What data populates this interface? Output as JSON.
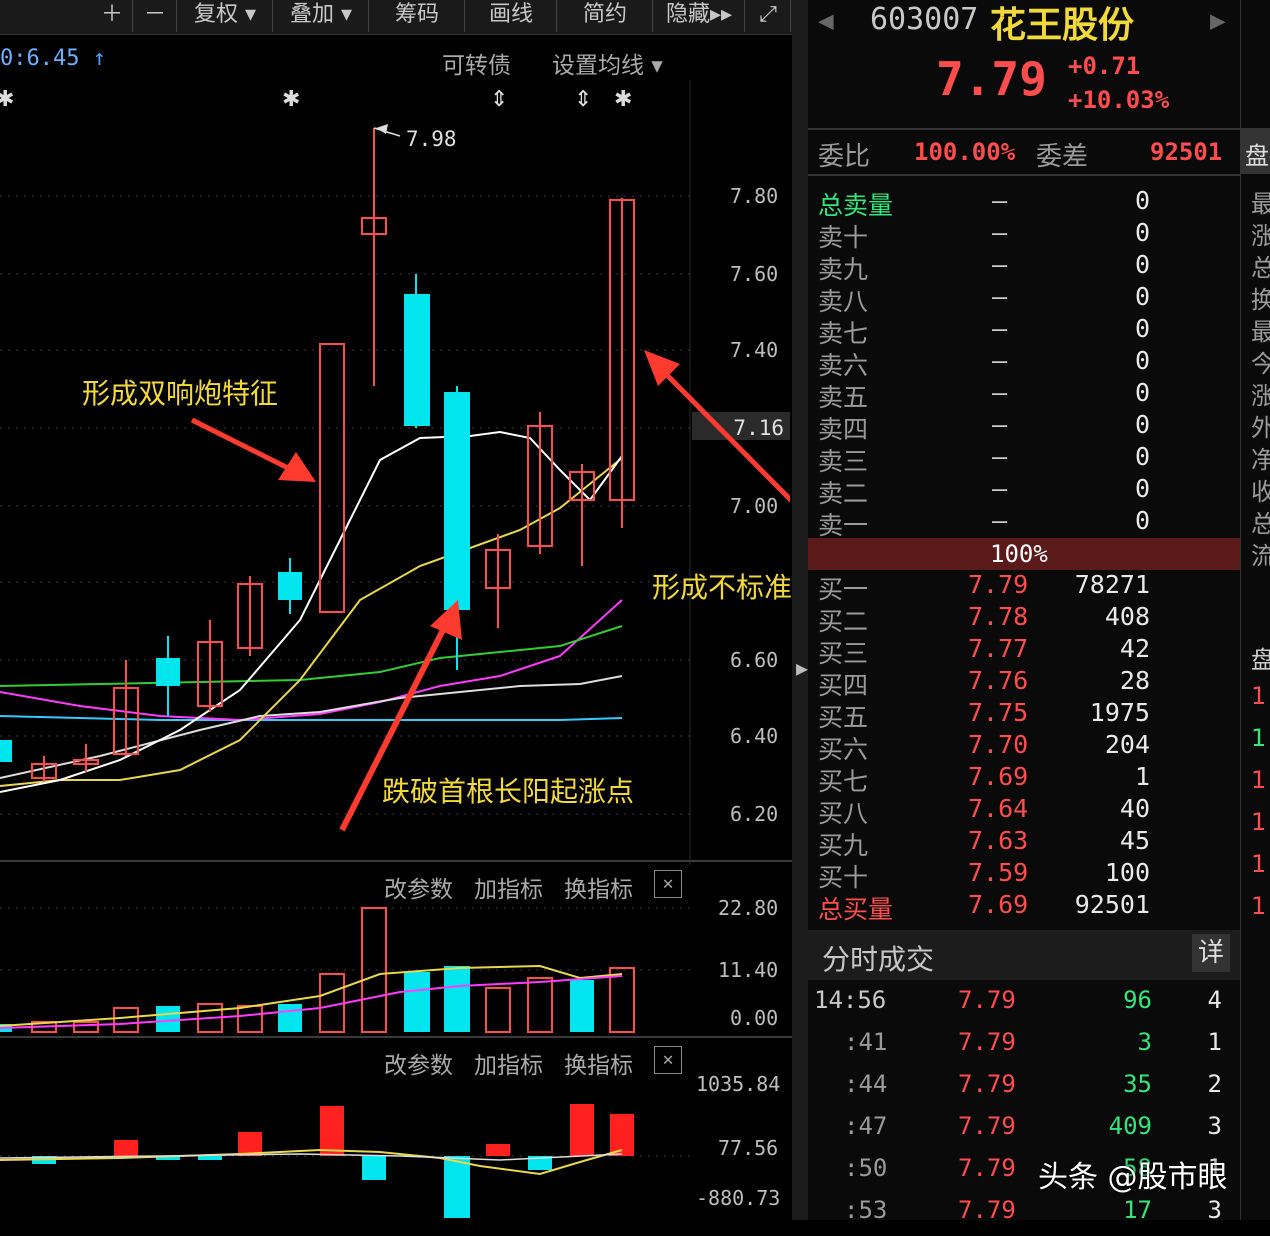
{
  "toolbar": {
    "items": [
      "＋",
      "－",
      "复权 ▾",
      "叠加 ▾",
      "筹码",
      "画线",
      "简约",
      "隐藏▸▸",
      "⤢"
    ]
  },
  "chart_header": {
    "ma_label": "0:6.45",
    "arrow": "↑",
    "convertible": "可转债",
    "set_ma": "设置均线 ▾",
    "high_label": "7.98",
    "current_price_tag": "7.16"
  },
  "price_axis": [
    "7.80",
    "7.60",
    "7.40",
    "7.00",
    "6.60",
    "6.40",
    "6.20"
  ],
  "annotations": {
    "a1": "形成双响炮特征",
    "a2": "跌破首根长阳起涨点",
    "a3": "形成不标准双响炮图形"
  },
  "volume_panel": {
    "buttons": [
      "改参数",
      "加指标",
      "换指标"
    ],
    "close": "✕",
    "axis": [
      "22.80",
      "11.40",
      "0.00"
    ]
  },
  "macd_panel": {
    "buttons": [
      "改参数",
      "加指标",
      "换指标"
    ],
    "close": "✕",
    "axis": [
      "1035.84",
      "77.56",
      "-880.73"
    ]
  },
  "stock": {
    "code": "603007",
    "name": "花王股份",
    "price": "7.79",
    "change": "+0.71",
    "change_pct": "+10.03%"
  },
  "weibi": {
    "label1": "委比",
    "value1": "100.00%",
    "label2": "委差",
    "value2": "92501",
    "side": "盘"
  },
  "sells": [
    {
      "label": "总卖量",
      "price": "—",
      "vol": "0"
    },
    {
      "label": "卖十",
      "price": "—",
      "vol": "0"
    },
    {
      "label": "卖九",
      "price": "—",
      "vol": "0"
    },
    {
      "label": "卖八",
      "price": "—",
      "vol": "0"
    },
    {
      "label": "卖七",
      "price": "—",
      "vol": "0"
    },
    {
      "label": "卖六",
      "price": "—",
      "vol": "0"
    },
    {
      "label": "卖五",
      "price": "—",
      "vol": "0"
    },
    {
      "label": "卖四",
      "price": "—",
      "vol": "0"
    },
    {
      "label": "卖三",
      "price": "—",
      "vol": "0"
    },
    {
      "label": "卖二",
      "price": "—",
      "vol": "0"
    },
    {
      "label": "卖一",
      "price": "—",
      "vol": "0"
    }
  ],
  "mid_bar": "100%",
  "buys": [
    {
      "label": "买一",
      "price": "7.79",
      "vol": "78271"
    },
    {
      "label": "买二",
      "price": "7.78",
      "vol": "408"
    },
    {
      "label": "买三",
      "price": "7.77",
      "vol": "42"
    },
    {
      "label": "买四",
      "price": "7.76",
      "vol": "28"
    },
    {
      "label": "买五",
      "price": "7.75",
      "vol": "1975"
    },
    {
      "label": "买六",
      "price": "7.70",
      "vol": "204"
    },
    {
      "label": "买七",
      "price": "7.69",
      "vol": "1"
    },
    {
      "label": "买八",
      "price": "7.64",
      "vol": "40"
    },
    {
      "label": "买九",
      "price": "7.63",
      "vol": "45"
    },
    {
      "label": "买十",
      "price": "7.59",
      "vol": "100"
    },
    {
      "label": "总买量",
      "price": "7.69",
      "vol": "92501"
    }
  ],
  "trades": {
    "title": "分时成交",
    "detail": "详",
    "rows": [
      {
        "time": "14:56",
        "price": "7.79",
        "vol": "96",
        "cnt": "4"
      },
      {
        "time": ":41",
        "price": "7.79",
        "vol": "3",
        "cnt": "1"
      },
      {
        "time": ":44",
        "price": "7.79",
        "vol": "35",
        "cnt": "2"
      },
      {
        "time": ":47",
        "price": "7.79",
        "vol": "409",
        "cnt": "3"
      },
      {
        "time": ":50",
        "price": "7.79",
        "vol": "58",
        "cnt": "1"
      },
      {
        "time": ":53",
        "price": "7.79",
        "vol": "17",
        "cnt": "3"
      }
    ]
  },
  "far_right": [
    "最",
    "涨",
    "总",
    "换",
    "最",
    "今",
    "涨",
    "外",
    "净",
    "收",
    "总",
    "流"
  ],
  "far_right_low": [
    "盘",
    "1",
    "1",
    "1",
    "1",
    "1",
    "1"
  ],
  "watermark": "头条 @股市眼",
  "colors": {
    "up": "#ff4d4d",
    "down": "#00e5ee",
    "bg": "#000000",
    "ma1": "#ffffff",
    "ma2": "#e8d84a",
    "ma3": "#ff3cff",
    "ma4": "#33cc33",
    "ma5": "#33ccff"
  }
}
